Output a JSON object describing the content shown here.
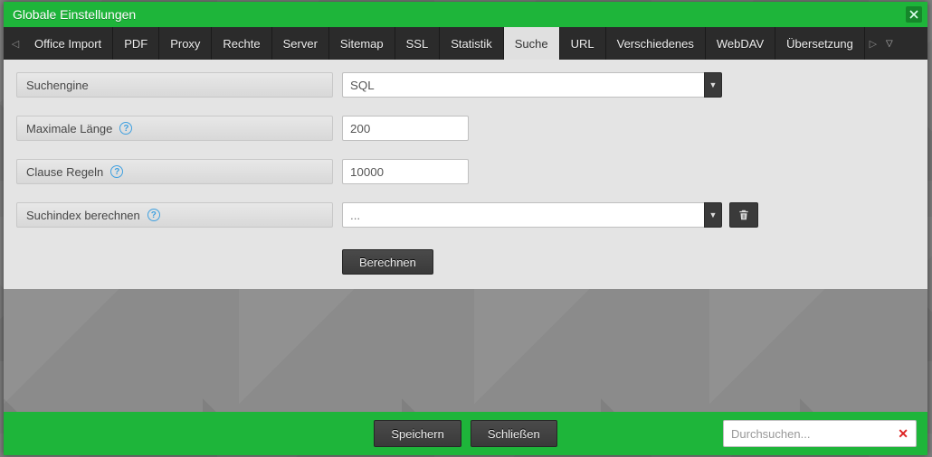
{
  "window": {
    "title": "Globale Einstellungen"
  },
  "tabs": {
    "items": [
      {
        "label": "Office Import"
      },
      {
        "label": "PDF"
      },
      {
        "label": "Proxy"
      },
      {
        "label": "Rechte"
      },
      {
        "label": "Server"
      },
      {
        "label": "Sitemap"
      },
      {
        "label": "SSL"
      },
      {
        "label": "Statistik"
      },
      {
        "label": "Suche"
      },
      {
        "label": "URL"
      },
      {
        "label": "Verschiedenes"
      },
      {
        "label": "WebDAV"
      },
      {
        "label": "Übersetzung"
      }
    ],
    "active_index": 8
  },
  "form": {
    "search_engine": {
      "label": "Suchengine",
      "value": "SQL"
    },
    "max_length": {
      "label": "Maximale Länge",
      "value": "200"
    },
    "clause_rules": {
      "label": "Clause Regeln",
      "value": "10000"
    },
    "calc_index": {
      "label": "Suchindex berechnen",
      "placeholder": "..."
    },
    "calc_button": {
      "label": "Berechnen"
    }
  },
  "footer": {
    "save": "Speichern",
    "close": "Schließen",
    "search_placeholder": "Durchsuchen..."
  },
  "colors": {
    "accent": "#1eb53a",
    "dark": "#3a3a3a"
  }
}
